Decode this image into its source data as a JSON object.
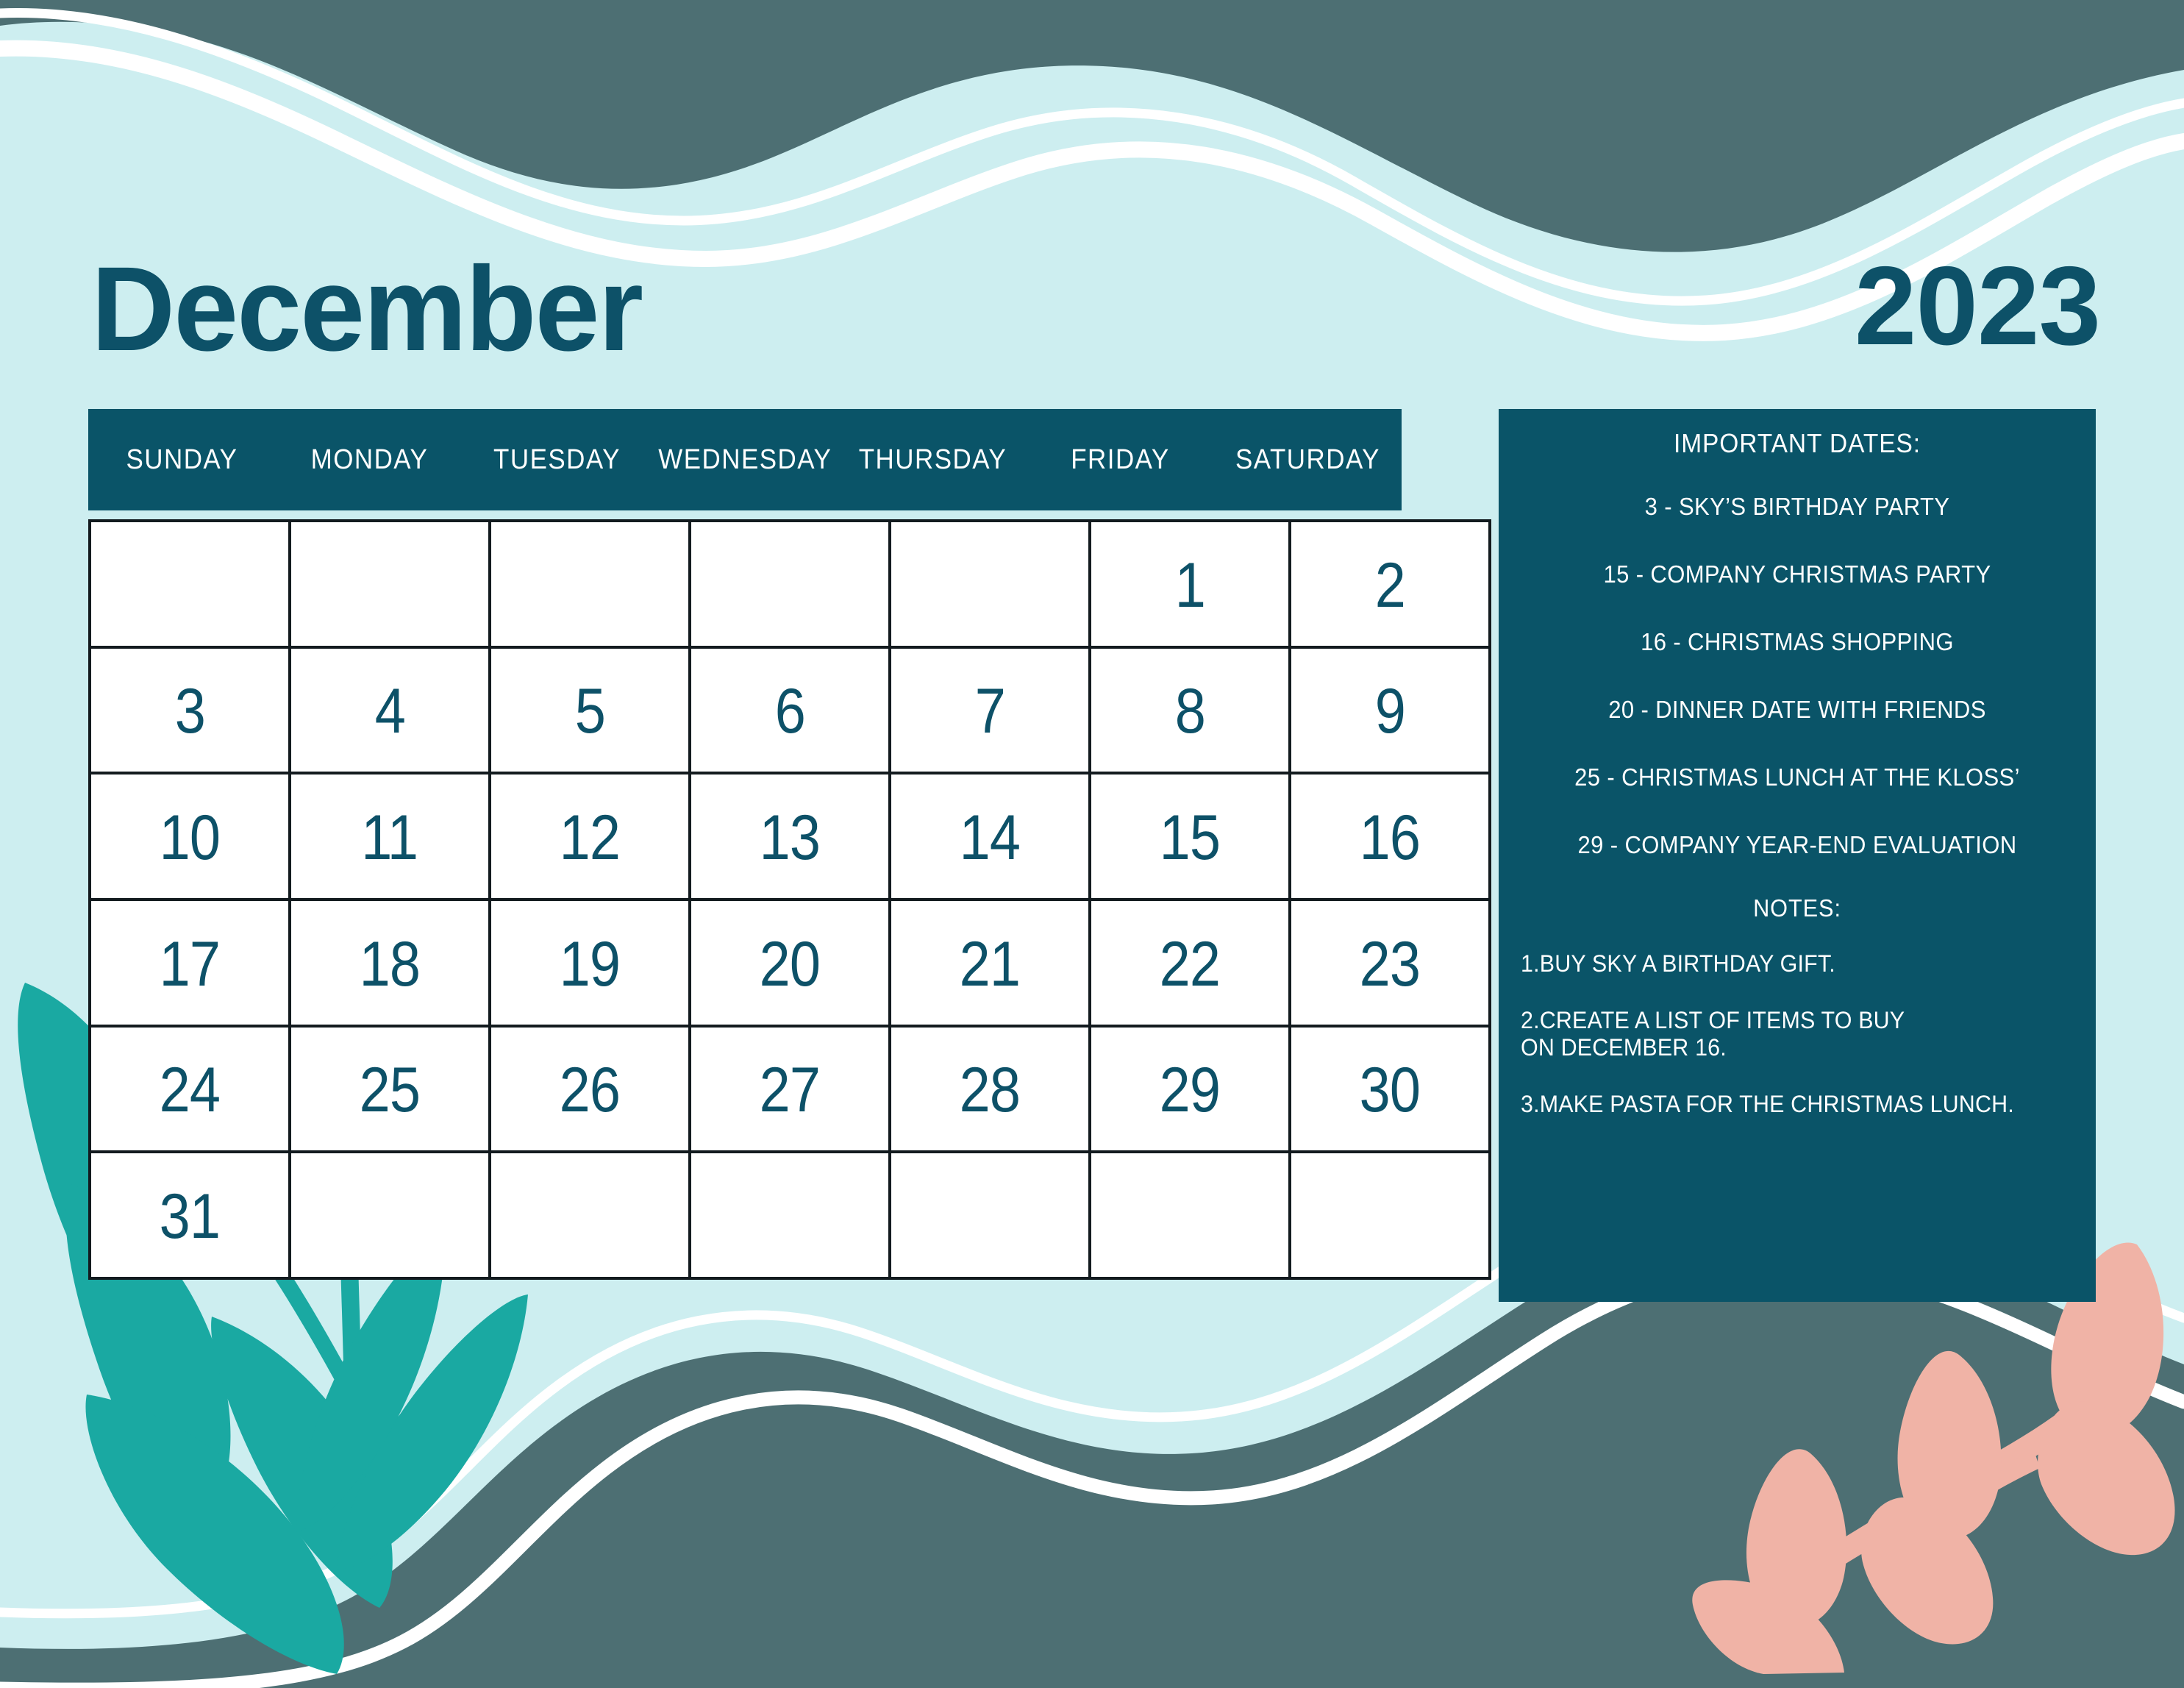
{
  "colors": {
    "background": "#cdeef0",
    "deep_teal": "#0a5468",
    "slate_teal": "#4d6f73",
    "leaf_teal": "#1aa9a2",
    "leaf_pink": "#f0b3a6",
    "grid_line": "#131b1f",
    "white": "#ffffff"
  },
  "header": {
    "month": "December",
    "year": "2023"
  },
  "weekdays": [
    "SUNDAY",
    "MONDAY",
    "TUESDAY",
    "WEDNESDAY",
    "THURSDAY",
    "FRIDAY",
    "SATURDAY"
  ],
  "grid": {
    "rows": [
      [
        "",
        "",
        "",
        "",
        "",
        "1",
        "2"
      ],
      [
        "3",
        "4",
        "5",
        "6",
        "7",
        "8",
        "9"
      ],
      [
        "10",
        "11",
        "12",
        "13",
        "14",
        "15",
        "16"
      ],
      [
        "17",
        "18",
        "19",
        "20",
        "21",
        "22",
        "23"
      ],
      [
        "24",
        "25",
        "26",
        "27",
        "28",
        "29",
        "30"
      ],
      [
        "31",
        "",
        "",
        "",
        "",
        "",
        ""
      ]
    ]
  },
  "panel": {
    "important_dates_heading": "IMPORTANT DATES:",
    "important_dates": [
      "3 - SKY’S BIRTHDAY PARTY",
      "15 -  COMPANY CHRISTMAS PARTY",
      "16 - CHRISTMAS SHOPPING",
      "20 - DINNER DATE WITH FRIENDS",
      "25 -  CHRISTMAS LUNCH AT THE KLOSS’",
      "29 - COMPANY YEAR-END EVALUATION"
    ],
    "notes_heading": "NOTES:",
    "notes": [
      "1.BUY SKY A BIRTHDAY GIFT.",
      "2.CREATE A LIST OF ITEMS TO BUY\nON DECEMBER 16.",
      "3.MAKE PASTA FOR THE CHRISTMAS LUNCH."
    ]
  }
}
